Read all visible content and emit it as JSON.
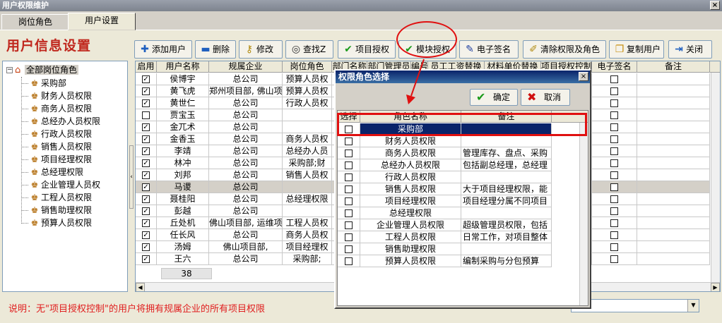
{
  "window": {
    "title": "用户权限维护",
    "close": "×"
  },
  "tabs": [
    {
      "label": "岗位角色",
      "active": false
    },
    {
      "label": "用户设置",
      "active": true
    }
  ],
  "page_title": "用户信息设置",
  "toolbar": {
    "add": "添加用户",
    "delete": "删除",
    "edit": "修改",
    "find": "查找Z",
    "project_auth": "项目授权",
    "module_auth": "模块授权",
    "esign": "电子签名",
    "clear": "清除权限及角色",
    "copy": "复制用户",
    "close": "关闭"
  },
  "tree": {
    "root": "全部岗位角色",
    "items": [
      "采购部",
      "财务人员权限",
      "商务人员权限",
      "总经办人员权限",
      "行政人员权限",
      "销售人员权限",
      "项目经理权限",
      "总经理权限",
      "企业管理人员权",
      "工程人员权限",
      "销售助理权限",
      "预算人员权限"
    ]
  },
  "grid": {
    "columns": [
      "启用",
      "用户名称",
      "规属企业",
      "岗位角色",
      "部门名称",
      "部门管理员",
      "编号",
      "员工工资替换",
      "材料单价替换",
      "项目授权控制",
      "电子签名",
      "备注"
    ],
    "rows": [
      {
        "enabled": true,
        "name": "侯博宇",
        "company": "总公司",
        "role": "预算人员权"
      },
      {
        "enabled": true,
        "name": "黄飞虎",
        "company": "郑州项目部, 佛山项",
        "role": "预算人员权"
      },
      {
        "enabled": true,
        "name": "黄世仁",
        "company": "总公司",
        "role": "行政人员权"
      },
      {
        "enabled": false,
        "name": "贾宝玉",
        "company": "总公司",
        "role": ""
      },
      {
        "enabled": true,
        "name": "金兀术",
        "company": "总公司",
        "role": ""
      },
      {
        "enabled": true,
        "name": "金香玉",
        "company": "总公司",
        "role": "商务人员权"
      },
      {
        "enabled": true,
        "name": "李靖",
        "company": "总公司",
        "role": "总经办人员"
      },
      {
        "enabled": true,
        "name": "林冲",
        "company": "总公司",
        "role": "采购部;财"
      },
      {
        "enabled": true,
        "name": "刘邦",
        "company": "总公司",
        "role": "销售人员权"
      },
      {
        "enabled": true,
        "name": "马谡",
        "company": "总公司",
        "role": "",
        "selected": true
      },
      {
        "enabled": true,
        "name": "聂桂阳",
        "company": "总公司",
        "role": "总经理权限"
      },
      {
        "enabled": true,
        "name": "彭越",
        "company": "总公司",
        "role": ""
      },
      {
        "enabled": true,
        "name": "丘处机",
        "company": "佛山项目部, 运维项",
        "role": "工程人员权"
      },
      {
        "enabled": true,
        "name": "任长风",
        "company": "总公司",
        "role": "商务人员权"
      },
      {
        "enabled": true,
        "name": "汤姆",
        "company": "佛山项目部,",
        "role": "项目经理权"
      },
      {
        "enabled": true,
        "name": "王六",
        "company": "总公司",
        "role": "采购部;"
      }
    ],
    "total": "38"
  },
  "footer_note": "说明：无\"项目授权控制\"的用户将拥有规属企业的所有项目权限",
  "dialog": {
    "title": "权限角色选择",
    "ok": "确定",
    "cancel": "取消",
    "columns": [
      "选择",
      "角色名称",
      "备注"
    ],
    "rows": [
      {
        "checked": true,
        "name": "采购部",
        "note": ""
      },
      {
        "checked": false,
        "name": "财务人员权限",
        "note": ""
      },
      {
        "checked": false,
        "name": "商务人员权限",
        "note": "管理库存、盘点、采购"
      },
      {
        "checked": false,
        "name": "总经办人员权限",
        "note": "包括副总经理，总经理"
      },
      {
        "checked": false,
        "name": "行政人员权限",
        "note": ""
      },
      {
        "checked": false,
        "name": "销售人员权限",
        "note": "大于项目经理权限，能"
      },
      {
        "checked": false,
        "name": "项目经理权限",
        "note": "项目经理分属不同项目"
      },
      {
        "checked": false,
        "name": "总经理权限",
        "note": ""
      },
      {
        "checked": false,
        "name": "企业管理人员权限",
        "note": "超级管理员权限，包括"
      },
      {
        "checked": false,
        "name": "工程人员权限",
        "note": "日常工作，对项目整体"
      },
      {
        "checked": false,
        "name": "销售助理权限",
        "note": ""
      },
      {
        "checked": false,
        "name": "预算人员权限",
        "note": "编制采购与分包预算"
      }
    ]
  },
  "colors": {
    "title_red": "#c0281e",
    "highlight": "#0a246a",
    "annotation": "#e01010",
    "note_red": "#e02020"
  },
  "icons": {
    "add": "plus-icon",
    "delete": "minus-icon",
    "edit": "key-icon",
    "find": "binoculars-icon",
    "auth": "checkmark-icon",
    "esign": "pen-icon",
    "clear": "eraser-icon",
    "copy": "copy-icon",
    "close": "exit-icon",
    "tree": "people-icon"
  }
}
